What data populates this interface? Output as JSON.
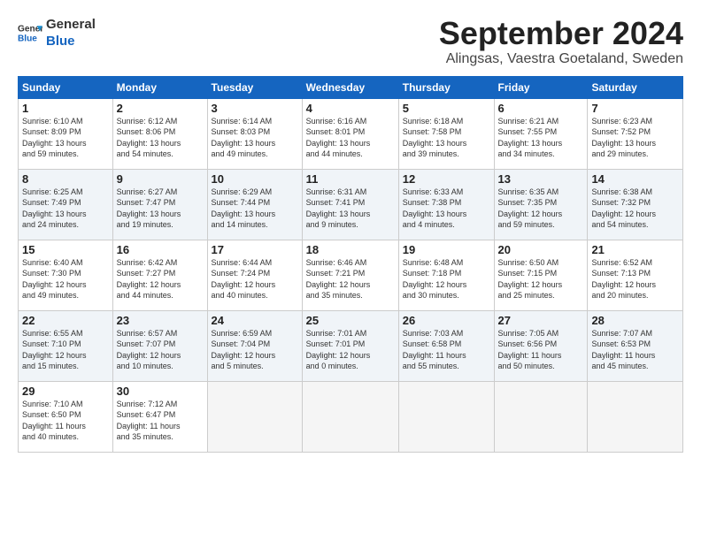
{
  "header": {
    "logo_line1": "General",
    "logo_line2": "Blue",
    "month_title": "September 2024",
    "location": "Alingsas, Vaestra Goetaland, Sweden"
  },
  "weekdays": [
    "Sunday",
    "Monday",
    "Tuesday",
    "Wednesday",
    "Thursday",
    "Friday",
    "Saturday"
  ],
  "weeks": [
    [
      {
        "day": "1",
        "info": "Sunrise: 6:10 AM\nSunset: 8:09 PM\nDaylight: 13 hours\nand 59 minutes."
      },
      {
        "day": "2",
        "info": "Sunrise: 6:12 AM\nSunset: 8:06 PM\nDaylight: 13 hours\nand 54 minutes."
      },
      {
        "day": "3",
        "info": "Sunrise: 6:14 AM\nSunset: 8:03 PM\nDaylight: 13 hours\nand 49 minutes."
      },
      {
        "day": "4",
        "info": "Sunrise: 6:16 AM\nSunset: 8:01 PM\nDaylight: 13 hours\nand 44 minutes."
      },
      {
        "day": "5",
        "info": "Sunrise: 6:18 AM\nSunset: 7:58 PM\nDaylight: 13 hours\nand 39 minutes."
      },
      {
        "day": "6",
        "info": "Sunrise: 6:21 AM\nSunset: 7:55 PM\nDaylight: 13 hours\nand 34 minutes."
      },
      {
        "day": "7",
        "info": "Sunrise: 6:23 AM\nSunset: 7:52 PM\nDaylight: 13 hours\nand 29 minutes."
      }
    ],
    [
      {
        "day": "8",
        "info": "Sunrise: 6:25 AM\nSunset: 7:49 PM\nDaylight: 13 hours\nand 24 minutes."
      },
      {
        "day": "9",
        "info": "Sunrise: 6:27 AM\nSunset: 7:47 PM\nDaylight: 13 hours\nand 19 minutes."
      },
      {
        "day": "10",
        "info": "Sunrise: 6:29 AM\nSunset: 7:44 PM\nDaylight: 13 hours\nand 14 minutes."
      },
      {
        "day": "11",
        "info": "Sunrise: 6:31 AM\nSunset: 7:41 PM\nDaylight: 13 hours\nand 9 minutes."
      },
      {
        "day": "12",
        "info": "Sunrise: 6:33 AM\nSunset: 7:38 PM\nDaylight: 13 hours\nand 4 minutes."
      },
      {
        "day": "13",
        "info": "Sunrise: 6:35 AM\nSunset: 7:35 PM\nDaylight: 12 hours\nand 59 minutes."
      },
      {
        "day": "14",
        "info": "Sunrise: 6:38 AM\nSunset: 7:32 PM\nDaylight: 12 hours\nand 54 minutes."
      }
    ],
    [
      {
        "day": "15",
        "info": "Sunrise: 6:40 AM\nSunset: 7:30 PM\nDaylight: 12 hours\nand 49 minutes."
      },
      {
        "day": "16",
        "info": "Sunrise: 6:42 AM\nSunset: 7:27 PM\nDaylight: 12 hours\nand 44 minutes."
      },
      {
        "day": "17",
        "info": "Sunrise: 6:44 AM\nSunset: 7:24 PM\nDaylight: 12 hours\nand 40 minutes."
      },
      {
        "day": "18",
        "info": "Sunrise: 6:46 AM\nSunset: 7:21 PM\nDaylight: 12 hours\nand 35 minutes."
      },
      {
        "day": "19",
        "info": "Sunrise: 6:48 AM\nSunset: 7:18 PM\nDaylight: 12 hours\nand 30 minutes."
      },
      {
        "day": "20",
        "info": "Sunrise: 6:50 AM\nSunset: 7:15 PM\nDaylight: 12 hours\nand 25 minutes."
      },
      {
        "day": "21",
        "info": "Sunrise: 6:52 AM\nSunset: 7:13 PM\nDaylight: 12 hours\nand 20 minutes."
      }
    ],
    [
      {
        "day": "22",
        "info": "Sunrise: 6:55 AM\nSunset: 7:10 PM\nDaylight: 12 hours\nand 15 minutes."
      },
      {
        "day": "23",
        "info": "Sunrise: 6:57 AM\nSunset: 7:07 PM\nDaylight: 12 hours\nand 10 minutes."
      },
      {
        "day": "24",
        "info": "Sunrise: 6:59 AM\nSunset: 7:04 PM\nDaylight: 12 hours\nand 5 minutes."
      },
      {
        "day": "25",
        "info": "Sunrise: 7:01 AM\nSunset: 7:01 PM\nDaylight: 12 hours\nand 0 minutes."
      },
      {
        "day": "26",
        "info": "Sunrise: 7:03 AM\nSunset: 6:58 PM\nDaylight: 11 hours\nand 55 minutes."
      },
      {
        "day": "27",
        "info": "Sunrise: 7:05 AM\nSunset: 6:56 PM\nDaylight: 11 hours\nand 50 minutes."
      },
      {
        "day": "28",
        "info": "Sunrise: 7:07 AM\nSunset: 6:53 PM\nDaylight: 11 hours\nand 45 minutes."
      }
    ],
    [
      {
        "day": "29",
        "info": "Sunrise: 7:10 AM\nSunset: 6:50 PM\nDaylight: 11 hours\nand 40 minutes."
      },
      {
        "day": "30",
        "info": "Sunrise: 7:12 AM\nSunset: 6:47 PM\nDaylight: 11 hours\nand 35 minutes."
      },
      {
        "day": "",
        "info": ""
      },
      {
        "day": "",
        "info": ""
      },
      {
        "day": "",
        "info": ""
      },
      {
        "day": "",
        "info": ""
      },
      {
        "day": "",
        "info": ""
      }
    ]
  ]
}
